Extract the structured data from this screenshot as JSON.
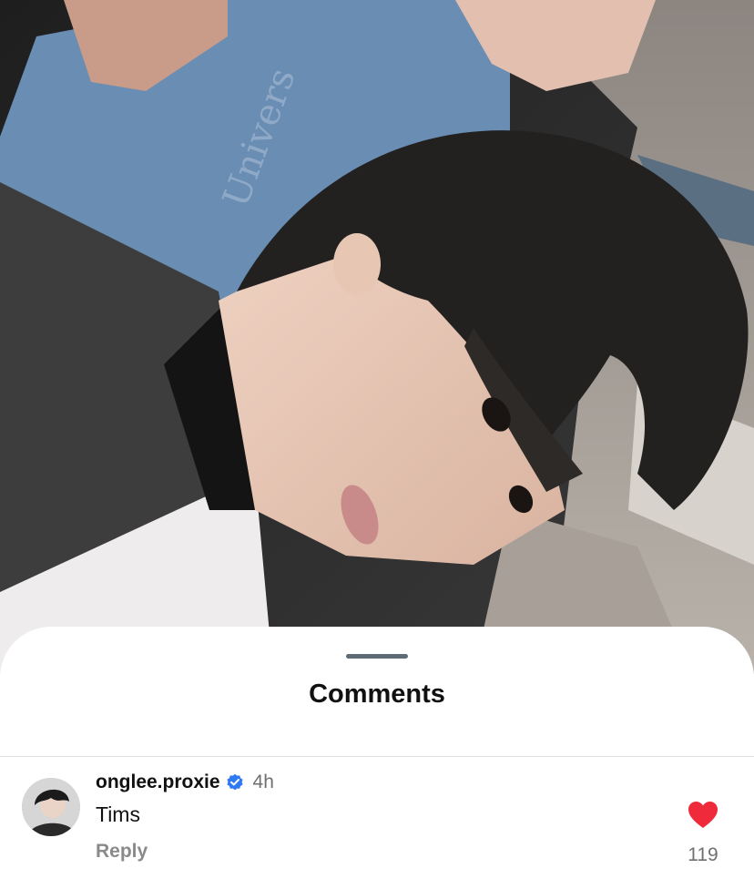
{
  "sheet": {
    "title": "Comments"
  },
  "comments": [
    {
      "username": "onglee.proxie",
      "verified": true,
      "time": "4h",
      "text": "Tims",
      "reply_label": "Reply",
      "likes": "119",
      "liked": true
    }
  ],
  "colors": {
    "like_heart": "#ee2a3b",
    "verified_badge": "#2f7af4",
    "secondary_text": "#707070",
    "grabber": "#5f6b74"
  },
  "icons": {
    "verified": "verified-badge-icon",
    "like": "heart-icon"
  }
}
